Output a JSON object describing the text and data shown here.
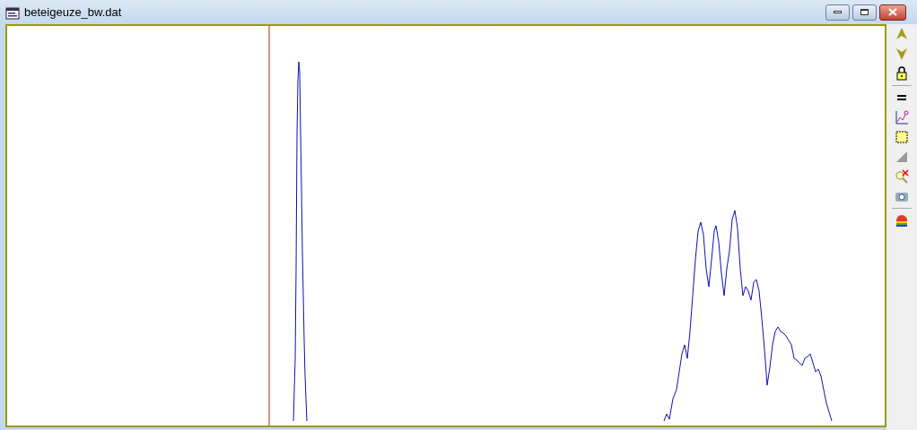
{
  "window": {
    "title": "beteigeuze_bw.dat"
  }
}
